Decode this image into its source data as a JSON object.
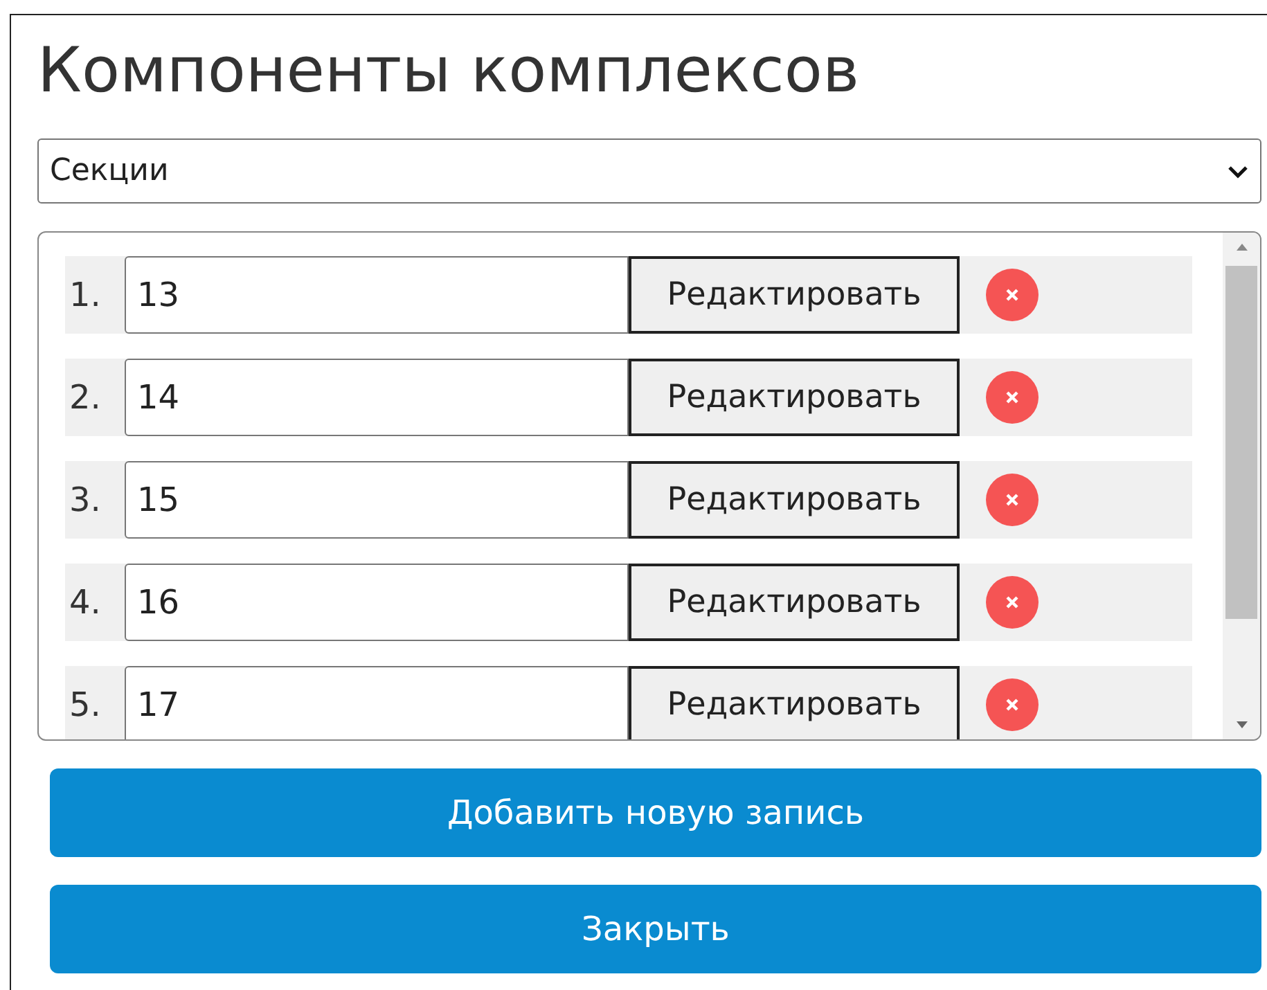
{
  "title": "Компоненты комплексов",
  "select": {
    "value": "Секции"
  },
  "rows": [
    {
      "number": "1.",
      "value": "13",
      "edit_label": "Редактировать"
    },
    {
      "number": "2.",
      "value": "14",
      "edit_label": "Редактировать"
    },
    {
      "number": "3.",
      "value": "15",
      "edit_label": "Редактировать"
    },
    {
      "number": "4.",
      "value": "16",
      "edit_label": "Редактировать"
    },
    {
      "number": "5.",
      "value": "17",
      "edit_label": "Редактировать"
    }
  ],
  "buttons": [
    "Добавить новую запись",
    "Закрыть"
  ]
}
